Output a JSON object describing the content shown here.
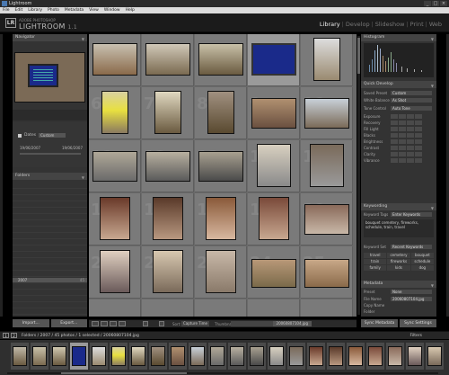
{
  "window": {
    "title": "Lightroom",
    "buttons": [
      "_",
      "□",
      "×"
    ]
  },
  "menu": [
    "File",
    "Edit",
    "Library",
    "Photo",
    "Metadata",
    "View",
    "Window",
    "Help"
  ],
  "identity": {
    "logo": "LR",
    "line1": "ADOBE PHOTOSHOP",
    "line2": "LIGHTROOM",
    "version": "1.1"
  },
  "modules": {
    "items": [
      "Library",
      "Develop",
      "Slideshow",
      "Print",
      "Web"
    ],
    "active": "Library",
    "separator": "|"
  },
  "left_panel": {
    "navigator_title": "Navigator",
    "date_select": "Custom",
    "date_label": "Dates",
    "date_start": "19/06/2007",
    "date_end": "19/06/2007",
    "folders_title": "Folders",
    "selected_folder": {
      "name": "2007",
      "count": "45"
    },
    "import_label": "Import...",
    "export_label": "Export..."
  },
  "grid_toolbar": {
    "sort_label": "Sort:",
    "sort_value": "Capture Time",
    "thumbnails_label": "Thumbnails",
    "filename": "20060807104.jpg"
  },
  "right_panel": {
    "histogram_title": "Histogram",
    "quick_develop_title": "Quick Develop",
    "saved_preset_label": "Saved Preset",
    "saved_preset_value": "Custom",
    "white_balance_label": "White Balance",
    "white_balance_value": "As Shot",
    "tone_control_label": "Tone Control",
    "tone_control_value": "Auto Tone",
    "tone_rows": [
      "Exposure",
      "Recovery",
      "Fill Light",
      "Blacks",
      "Brightness",
      "Contrast",
      "Clarity",
      "Vibrance"
    ],
    "keywording_title": "Keywording",
    "keyword_tags_label": "Keyword Tags",
    "keyword_tags_value": "Enter Keywords",
    "keywords_text": "bouquet cemetery, fireworks, schedule, train, travel",
    "keyword_set_label": "Keyword Set",
    "keyword_set_value": "Recent Keywords",
    "keyword_set_items": [
      "travel",
      "cemetery",
      "bouquet",
      "train",
      "fireworks",
      "schedule",
      "family",
      "kids",
      "dog"
    ],
    "metadata_title": "Metadata",
    "preset_label": "Preset",
    "preset_value": "None",
    "file_name_label": "File Name",
    "file_name_value": "20060807104.jpg",
    "copy_name_label": "Copy Name",
    "folder_label": "Folder",
    "sync_label": "Sync Settings",
    "sync_meta_label": "Sync Metadata"
  },
  "filmstrip_bar": {
    "display1": "1",
    "display2": "2",
    "path": "Folders / 2007 / 45 photos / 1 selected / 20060807104.jpg",
    "filters_label": "Filters"
  },
  "colors": {
    "accent": "#999999",
    "panel": "#333333",
    "grid_bg": "#6a6a6a"
  }
}
